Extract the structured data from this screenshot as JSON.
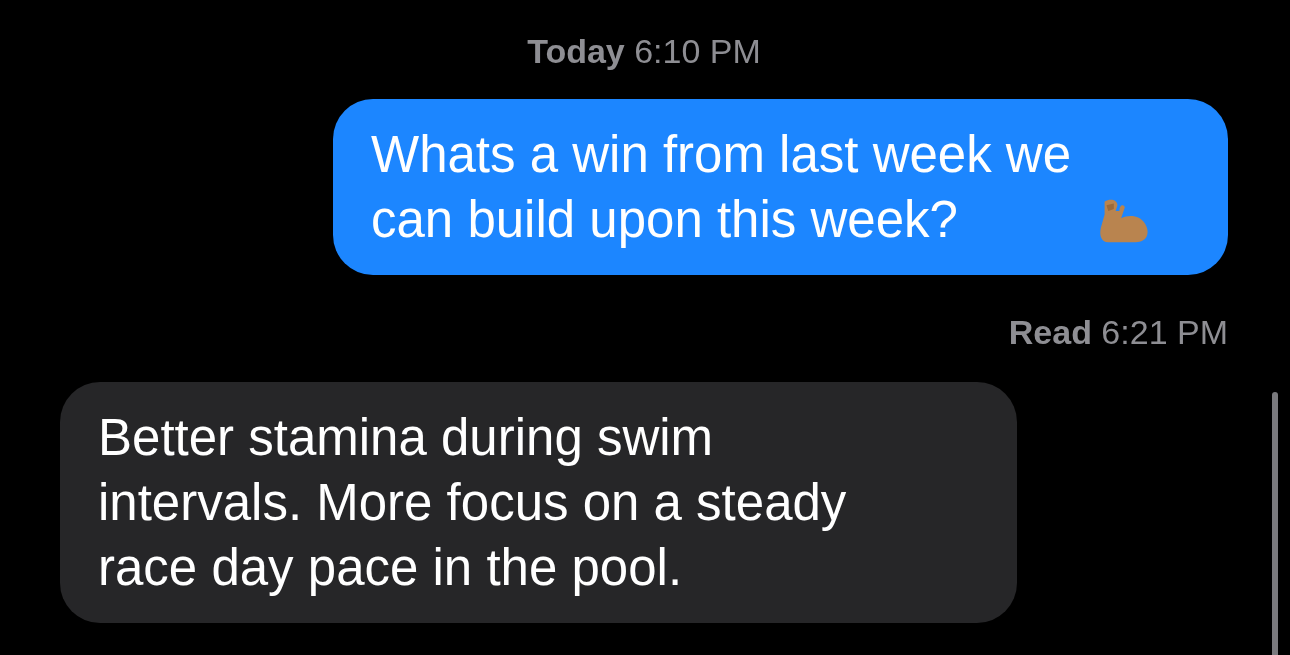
{
  "timestamp": "**Today** 6:10 PM",
  "messages": [
    {
      "kind": "sent",
      "text": "Whats a win from last week we can build upon this week?",
      "trailing_icon": true,
      "receipt": "**Read** 6:21 PM"
    },
    {
      "kind": "received",
      "text": "Better stamina during swim intervals. More focus on a steady race day pace in the pool."
    }
  ]
}
